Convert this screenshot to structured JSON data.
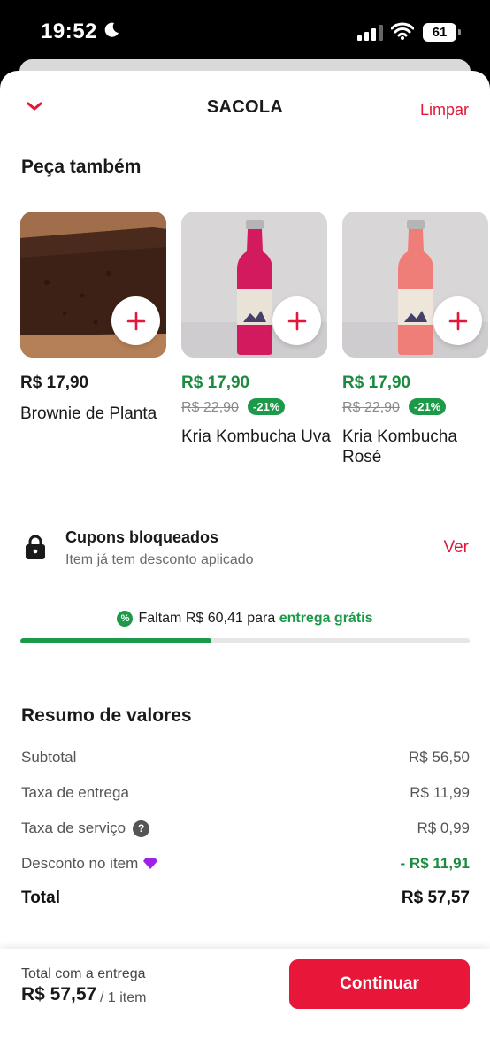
{
  "status_bar": {
    "time": "19:52",
    "battery": "61"
  },
  "header": {
    "title": "SACOLA",
    "clear_label": "Limpar"
  },
  "suggestions": {
    "title": "Peça também",
    "products": [
      {
        "name": "Brownie de Planta",
        "price": "R$ 17,90",
        "old_price": "",
        "discount": ""
      },
      {
        "name": "Kria Kombucha Uva",
        "price": "R$ 17,90",
        "old_price": "R$ 22,90",
        "discount": "-21%"
      },
      {
        "name": "Kria Kombucha Rosé",
        "price": "R$ 17,90",
        "old_price": "R$ 22,90",
        "discount": "-21%"
      }
    ]
  },
  "coupon": {
    "title": "Cupons bloqueados",
    "subtitle": "Item já tem desconto aplicado",
    "action": "Ver"
  },
  "free_delivery": {
    "prefix": "Faltam R$ 60,41 para",
    "highlight": "entrega grátis",
    "icon": "%",
    "progress": 0.425
  },
  "summary": {
    "title": "Resumo de valores",
    "subtotal_label": "Subtotal",
    "subtotal_value": "R$ 56,50",
    "delivery_label": "Taxa de entrega",
    "delivery_value": "R$ 11,99",
    "service_label": "Taxa de serviço",
    "service_value": "R$ 0,99",
    "discount_label": "Desconto no item",
    "discount_value": "- R$ 11,91",
    "total_label": "Total",
    "total_value": "R$ 57,57"
  },
  "footer": {
    "label": "Total com a entrega",
    "total": "R$ 57,57",
    "items": "/ 1 item",
    "continue_label": "Continuar"
  },
  "colors": {
    "accent": "#e8173a",
    "green": "#1c9a49"
  }
}
